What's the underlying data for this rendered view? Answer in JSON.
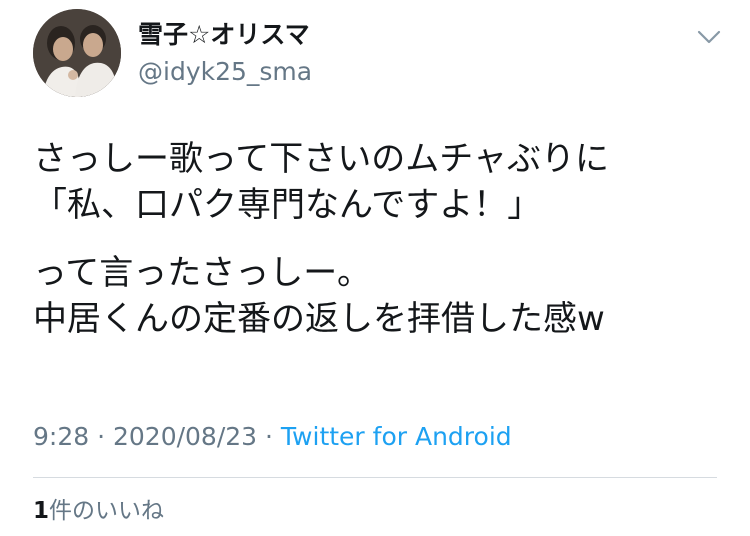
{
  "author": {
    "display_name": "雪子☆オリスマ",
    "handle": "@idyk25_sma"
  },
  "tweet": {
    "lines_para1": [
      "さっしー歌って下さいのムチャぶりに",
      "「私、口パク専門なんですよ！」"
    ],
    "lines_para2": [
      "って言ったさっしー。",
      "中居くんの定番の返しを拝借した感w"
    ]
  },
  "meta": {
    "time": "9:28",
    "sep1": " · ",
    "date": "2020/08/23",
    "sep2": " · ",
    "source": "Twitter for Android"
  },
  "likes": {
    "count": "1",
    "label": "件のいいね"
  },
  "icons": {
    "menu": "chevron-down-icon"
  },
  "colors": {
    "text": "#14171a",
    "secondary": "#657786",
    "link": "#1da1f2",
    "divider": "#d6dbe0"
  }
}
